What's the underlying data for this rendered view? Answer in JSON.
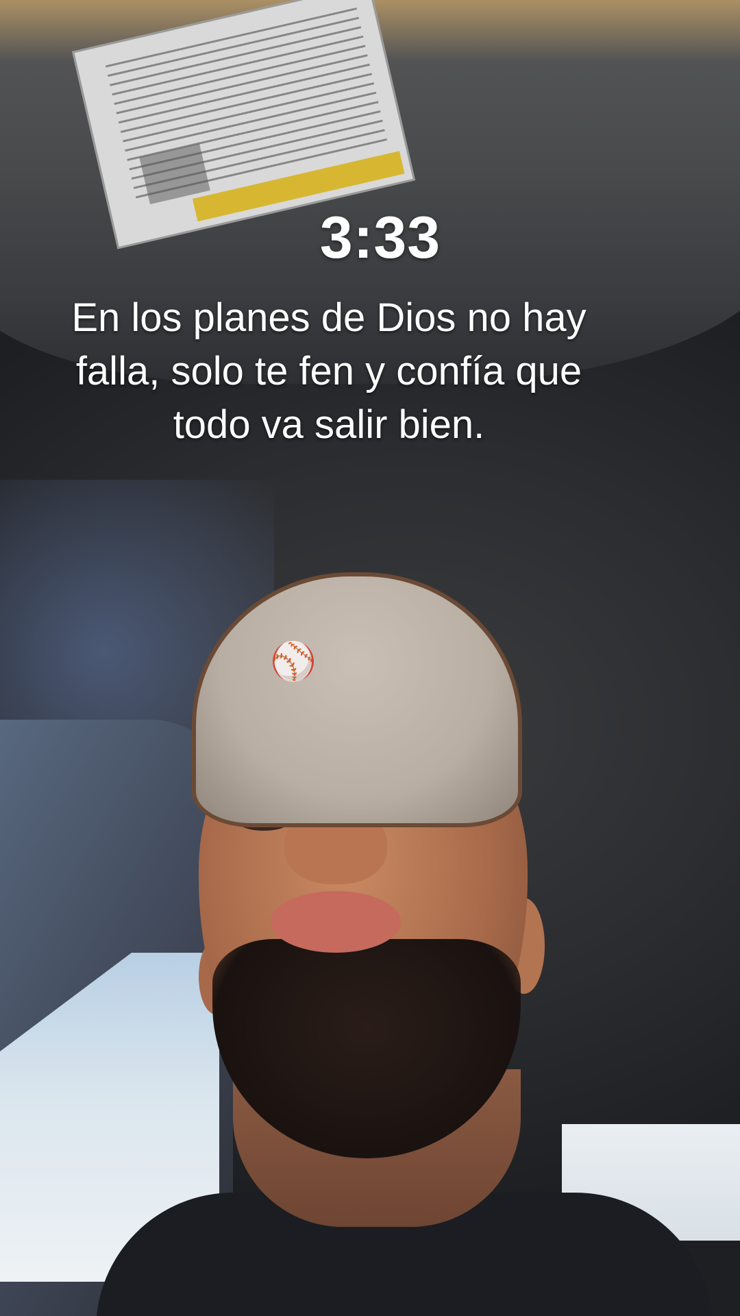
{
  "overlay": {
    "clock": "3:33",
    "quote_lines": [
      "En los planes de Dios no hay",
      "falla, solo te fen y confía que",
      "todo va salir bien."
    ]
  },
  "photo": {
    "subject": "man in baseball cap inside a car, looking upward",
    "cap_icon": "baseball-icon"
  },
  "colors": {
    "text": "#ffffff",
    "cap": "#c9bfb5",
    "visor_label_accent": "#d7b732"
  }
}
